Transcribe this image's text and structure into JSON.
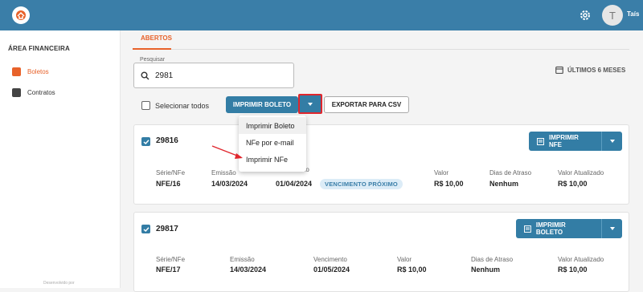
{
  "topbar": {
    "username": "Taís",
    "avatar_letter": "T",
    "color": "#3a7ea8"
  },
  "sidebar": {
    "title": "ÁREA FINANCEIRA",
    "items": [
      {
        "label": "Boletos",
        "icon": "boleto-icon",
        "active": true
      },
      {
        "label": "Contratos",
        "icon": "contract-icon",
        "active": false
      }
    ],
    "footer": "Desenvolvido por"
  },
  "tabs": [
    {
      "label": "ABERTOS",
      "active": true
    }
  ],
  "search": {
    "label": "Pesquisar",
    "value": "2981"
  },
  "period": {
    "label": "ÚLTIMOS 6 MESES"
  },
  "toolbar": {
    "select_all_label": "Selecionar todos",
    "print_boleto_label": "IMPRIMIR BOLETO",
    "export_csv_label": "EXPORTAR PARA CSV"
  },
  "dropdown_menu": {
    "items": [
      "Imprimir Boleto",
      "NFe por e-mail",
      "Imprimir NFe"
    ]
  },
  "cards": [
    {
      "number": "29816",
      "action_label": "IMPRIMIR NFE",
      "fields": [
        {
          "label": "Série/NFe",
          "value": "NFE/16"
        },
        {
          "label": "Emissão",
          "value": "14/03/2024"
        },
        {
          "label": "Vencimento",
          "value": "01/04/2024"
        },
        {
          "label": "Valor",
          "value": "R$ 10,00"
        },
        {
          "label": "Dias de Atraso",
          "value": "Nenhum"
        },
        {
          "label": "Valor Atualizado",
          "value": "R$ 10,00"
        }
      ],
      "badge": "VENCIMENTO PRÓXIMO"
    },
    {
      "number": "29817",
      "action_label": "IMPRIMIR BOLETO",
      "fields": [
        {
          "label": "Série/NFe",
          "value": "NFE/17"
        },
        {
          "label": "Emissão",
          "value": "14/03/2024"
        },
        {
          "label": "Vencimento",
          "value": "01/05/2024"
        },
        {
          "label": "Valor",
          "value": "R$ 10,00"
        },
        {
          "label": "Dias de Atraso",
          "value": "Nenhum"
        },
        {
          "label": "Valor Atualizado",
          "value": "R$ 10,00"
        }
      ]
    }
  ],
  "colors": {
    "accent": "#e8622a",
    "primary": "#337da5",
    "highlight": "#e0262d",
    "annotation_arrow": "#e0262d"
  }
}
